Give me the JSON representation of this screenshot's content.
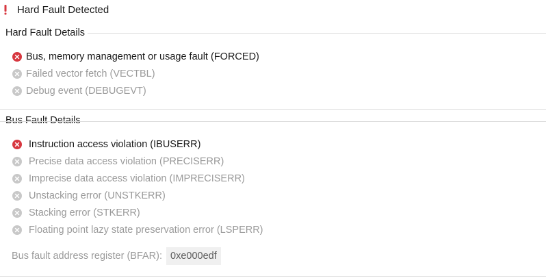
{
  "title": "Hard Fault Detected",
  "hard_fault": {
    "title": "Hard Fault Details",
    "items": [
      {
        "label": "Bus, memory management or usage fault (FORCED)",
        "active": true
      },
      {
        "label": "Failed vector fetch (VECTBL)",
        "active": false
      },
      {
        "label": "Debug event (DEBUGEVT)",
        "active": false
      }
    ]
  },
  "bus_fault": {
    "title": "Bus Fault Details",
    "items": [
      {
        "label": "Instruction access violation (IBUSERR)",
        "active": true
      },
      {
        "label": "Precise data access violation (PRECISERR)",
        "active": false
      },
      {
        "label": "Imprecise data access violation (IMPRECISERR)",
        "active": false
      },
      {
        "label": "Unstacking error (UNSTKERR)",
        "active": false
      },
      {
        "label": "Stacking error (STKERR)",
        "active": false
      },
      {
        "label": "Floating point lazy state preservation error (LSPERR)",
        "active": false
      }
    ],
    "bfar_label": "Bus fault address register (BFAR):",
    "bfar_value": "0xe000edf"
  },
  "colors": {
    "error_red": "#d7373f",
    "inactive_gray": "#c8c8c8",
    "inactive_text": "#9a9a9a"
  }
}
